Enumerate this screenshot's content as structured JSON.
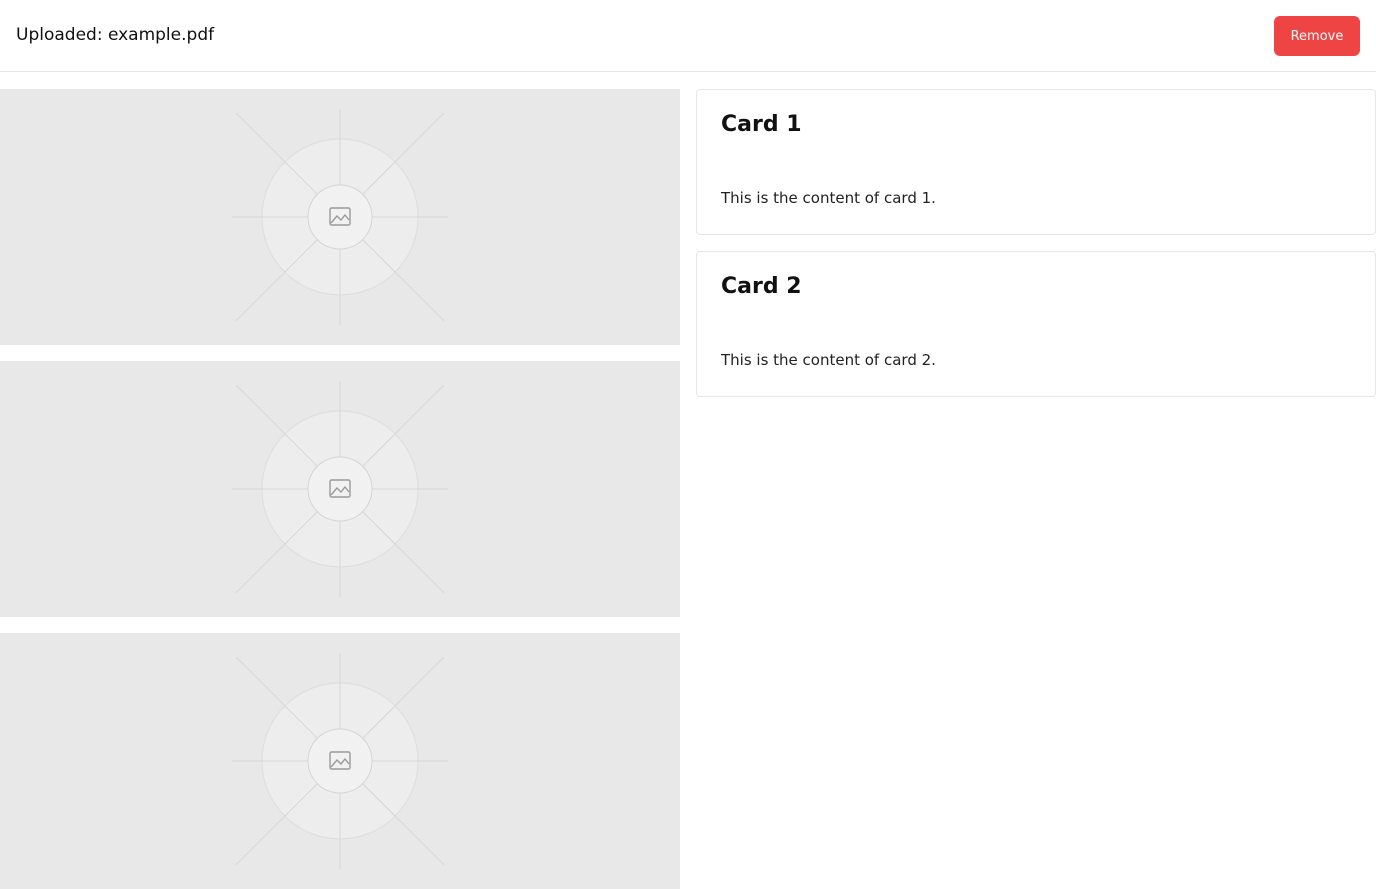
{
  "header": {
    "title": "Uploaded: example.pdf",
    "remove_label": "Remove",
    "remove_color": "#ef4444"
  },
  "images": [
    {
      "icon": "image-placeholder-icon"
    },
    {
      "icon": "image-placeholder-icon"
    },
    {
      "icon": "image-placeholder-icon"
    }
  ],
  "cards": [
    {
      "title": "Card 1",
      "content": "This is the content of card 1."
    },
    {
      "title": "Card 2",
      "content": "This is the content of card 2."
    }
  ]
}
